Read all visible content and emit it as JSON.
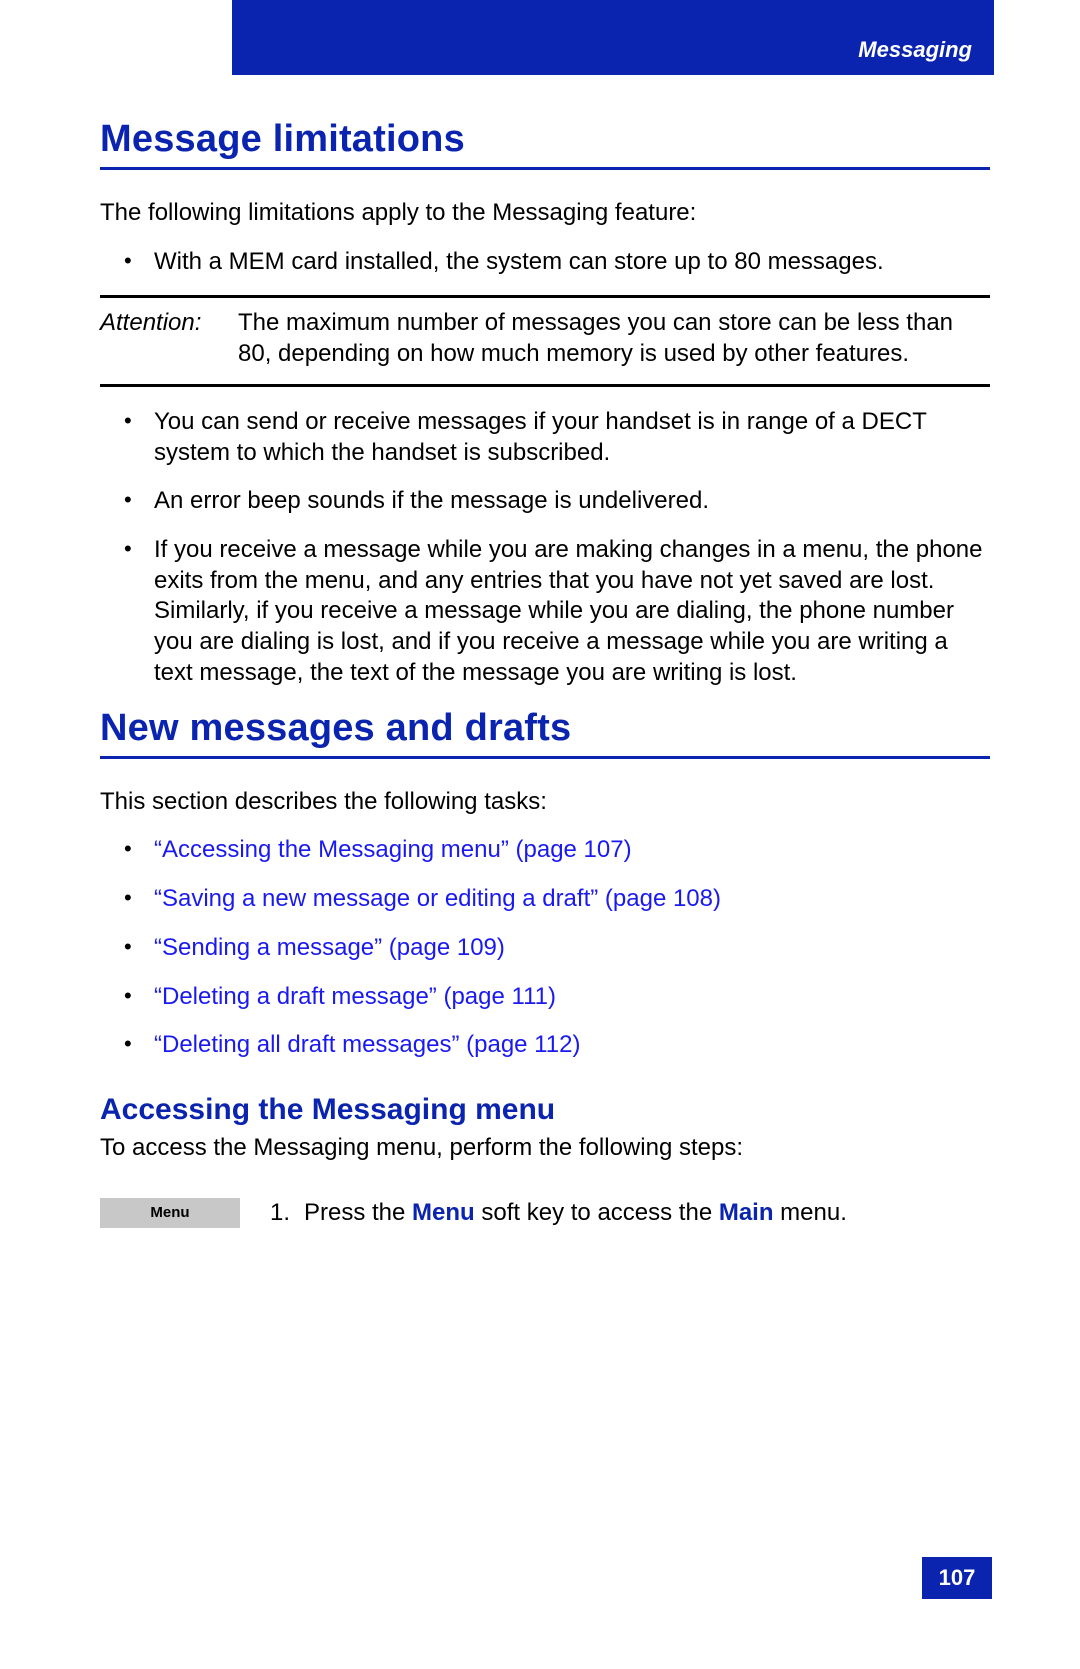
{
  "header": {
    "section": "Messaging"
  },
  "sections": {
    "limitations": {
      "title": "Message limitations",
      "intro": "The following limitations apply to the Messaging feature:",
      "bullet1": "With a MEM card installed, the system can store up to 80 messages.",
      "attention_label": "Attention:",
      "attention_text": "The maximum number of messages you can store can be less than 80, depending on how much memory is used by other features.",
      "bullet2": "You can send or receive messages if your handset is in range of a DECT system to which the handset is subscribed.",
      "bullet3": "An error beep sounds if the message is undelivered.",
      "bullet4": "If you receive a message while you are making changes in a menu, the phone exits from the menu, and any entries that you have not yet saved are lost. Similarly, if you receive a message while you are dialing, the phone number you are dialing is lost, and if you receive a message while you are writing a text message, the text of the message you are writing is lost."
    },
    "newmsg": {
      "title": "New messages and drafts",
      "intro": "This section describes the following tasks:",
      "links": [
        "“Accessing the Messaging menu” (page 107)",
        "“Saving a new message or editing a draft” (page 108)",
        "“Sending a message” (page 109)",
        "“Deleting a draft message” (page 111)",
        "“Deleting all draft messages” (page 112)"
      ]
    },
    "accessing": {
      "title": "Accessing the Messaging menu",
      "intro": "To access the Messaging menu, perform the following steps:",
      "step1": {
        "softkey": "Menu",
        "num": "1.",
        "before": "Press the ",
        "kw1": "Menu",
        "mid": " soft key to access the ",
        "kw2": "Main",
        "after": " menu."
      }
    }
  },
  "page_number": "107"
}
